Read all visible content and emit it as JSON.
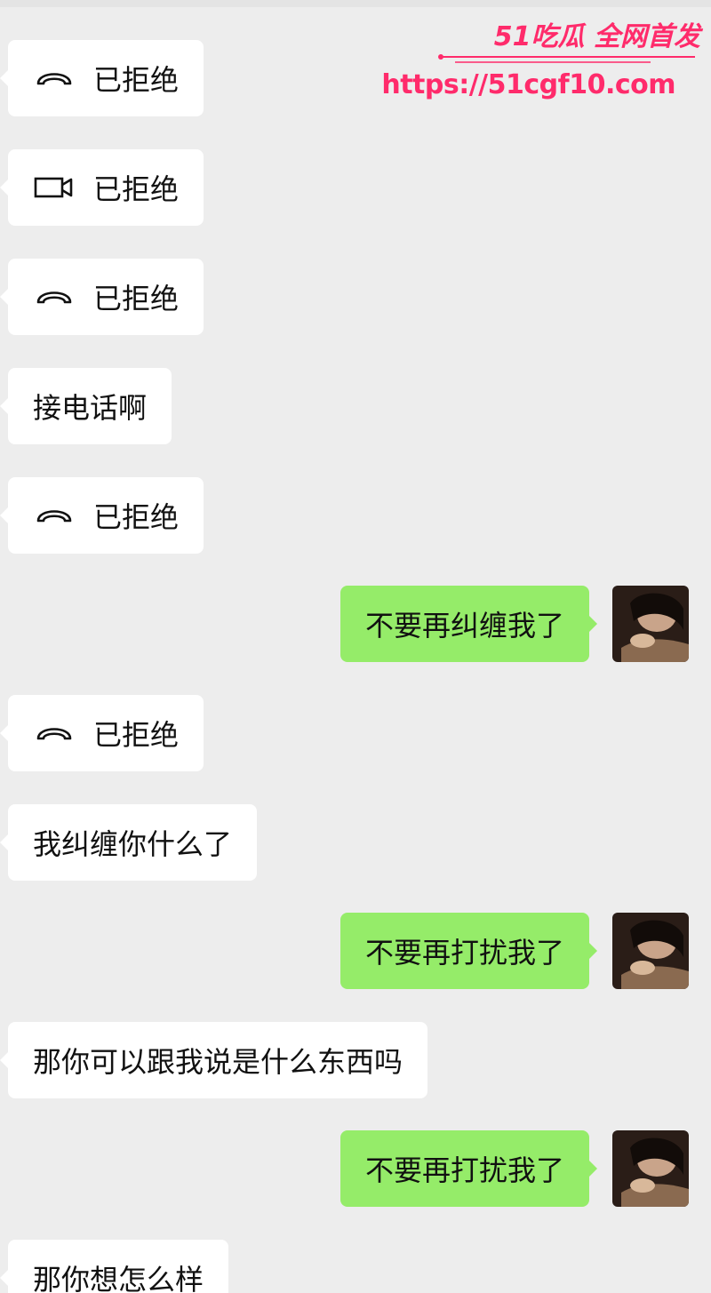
{
  "watermark": {
    "brand": "51吃瓜 全网首发",
    "url": "https://51cgf10.com",
    "color": "#ff2b6b"
  },
  "colors": {
    "background": "#ededed",
    "incoming_bubble": "#ffffff",
    "outgoing_bubble": "#95ec69"
  },
  "messages": [
    {
      "direction": "in",
      "kind": "voice-call",
      "icon": "phone-hangup-icon",
      "text": "已拒绝"
    },
    {
      "direction": "in",
      "kind": "video-call",
      "icon": "video-camera-icon",
      "text": "已拒绝"
    },
    {
      "direction": "in",
      "kind": "voice-call",
      "icon": "phone-hangup-icon",
      "text": "已拒绝"
    },
    {
      "direction": "in",
      "kind": "text",
      "text": "接电话啊"
    },
    {
      "direction": "in",
      "kind": "voice-call",
      "icon": "phone-hangup-icon",
      "text": "已拒绝"
    },
    {
      "direction": "out",
      "kind": "text",
      "text": "不要再纠缠我了"
    },
    {
      "direction": "in",
      "kind": "voice-call",
      "icon": "phone-hangup-icon",
      "text": "已拒绝"
    },
    {
      "direction": "in",
      "kind": "text",
      "text": "我纠缠你什么了"
    },
    {
      "direction": "out",
      "kind": "text",
      "text": "不要再打扰我了"
    },
    {
      "direction": "in",
      "kind": "text",
      "text": "那你可以跟我说是什么东西吗"
    },
    {
      "direction": "out",
      "kind": "text",
      "text": "不要再打扰我了"
    },
    {
      "direction": "in",
      "kind": "text",
      "text": "那你想怎么样"
    }
  ]
}
